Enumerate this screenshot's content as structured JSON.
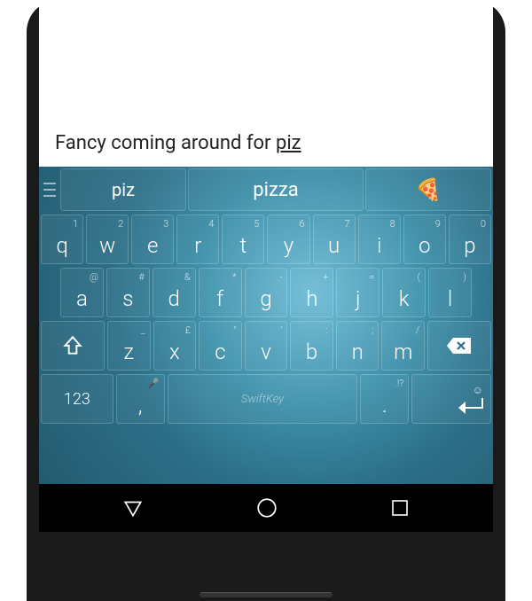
{
  "text_input": {
    "typed": "Fancy coming around for ",
    "partial": "piz"
  },
  "suggestions": {
    "left": "piz",
    "center": "pizza",
    "right_emoji": "🍕"
  },
  "keyboard": {
    "row1": [
      {
        "main": "q",
        "hint": "1"
      },
      {
        "main": "w",
        "hint": "2"
      },
      {
        "main": "e",
        "hint": "3"
      },
      {
        "main": "r",
        "hint": "4"
      },
      {
        "main": "t",
        "hint": "5"
      },
      {
        "main": "y",
        "hint": "6"
      },
      {
        "main": "u",
        "hint": "7"
      },
      {
        "main": "i",
        "hint": "8"
      },
      {
        "main": "o",
        "hint": "9"
      },
      {
        "main": "p",
        "hint": "0"
      }
    ],
    "row2": [
      {
        "main": "a",
        "hint": "@"
      },
      {
        "main": "s",
        "hint": "#"
      },
      {
        "main": "d",
        "hint": "&"
      },
      {
        "main": "f",
        "hint": "*"
      },
      {
        "main": "g",
        "hint": "-"
      },
      {
        "main": "h",
        "hint": "+"
      },
      {
        "main": "j",
        "hint": "="
      },
      {
        "main": "k",
        "hint": "("
      },
      {
        "main": "l",
        "hint": ")"
      }
    ],
    "row3": [
      {
        "main": "z",
        "hint": "_"
      },
      {
        "main": "x",
        "hint": "£"
      },
      {
        "main": "c",
        "hint": "\""
      },
      {
        "main": "v",
        "hint": "'"
      },
      {
        "main": "b",
        "hint": ":"
      },
      {
        "main": "n",
        "hint": ";"
      },
      {
        "main": "m",
        "hint": "/"
      }
    ],
    "row4": {
      "numbers": "123",
      "comma": ",",
      "comma_hint": "🎤",
      "brand": "SwiftKey",
      "period": ".",
      "period_hint": ".!?",
      "smile_hint": "☺"
    }
  }
}
